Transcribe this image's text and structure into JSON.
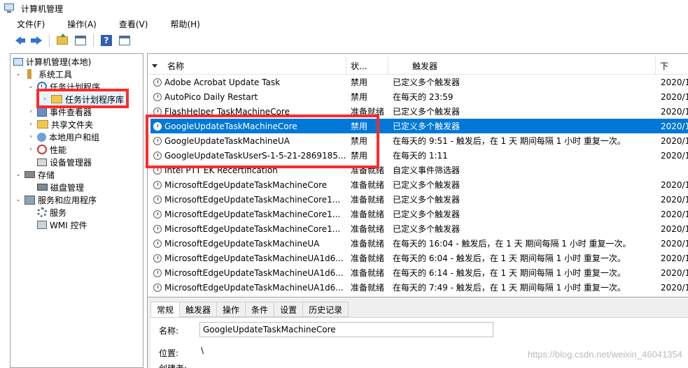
{
  "window": {
    "title": "计算机管理"
  },
  "menu": [
    "文件(F)",
    "操作(A)",
    "查看(V)",
    "帮助(H)"
  ],
  "toolbar": [
    "back-arrow-icon",
    "forward-arrow-icon",
    "folder-up-icon",
    "show-pane-icon",
    "help-icon",
    "properties-icon"
  ],
  "tree": [
    {
      "label": "计算机管理(本地)",
      "icon": "computer-icon",
      "depth": 0,
      "expander": ""
    },
    {
      "label": "系统工具",
      "icon": "tools-icon",
      "depth": 1,
      "expander": "⌄"
    },
    {
      "label": "任务计划程序",
      "icon": "clock-icon",
      "depth": 2,
      "expander": "⌄"
    },
    {
      "label": "任务计划程序库",
      "icon": "folder-clock-icon",
      "depth": 3,
      "expander": "›",
      "selected": true
    },
    {
      "label": "事件查看器",
      "icon": "event-viewer-icon",
      "depth": 2,
      "expander": "›"
    },
    {
      "label": "共享文件夹",
      "icon": "shared-folder-icon",
      "depth": 2,
      "expander": "›"
    },
    {
      "label": "本地用户和组",
      "icon": "users-icon",
      "depth": 2,
      "expander": "›"
    },
    {
      "label": "性能",
      "icon": "performance-icon",
      "depth": 2,
      "expander": "›"
    },
    {
      "label": "设备管理器",
      "icon": "device-manager-icon",
      "depth": 2,
      "expander": ""
    },
    {
      "label": "存储",
      "icon": "storage-icon",
      "depth": 1,
      "expander": "⌄"
    },
    {
      "label": "磁盘管理",
      "icon": "disk-icon",
      "depth": 2,
      "expander": ""
    },
    {
      "label": "服务和应用程序",
      "icon": "services-apps-icon",
      "depth": 1,
      "expander": "⌄"
    },
    {
      "label": "服务",
      "icon": "gear-icon",
      "depth": 2,
      "expander": ""
    },
    {
      "label": "WMI 控件",
      "icon": "wmi-icon",
      "depth": 2,
      "expander": ""
    }
  ],
  "list": {
    "columns": [
      "名称",
      "状...",
      "触发器",
      "下"
    ],
    "rows": [
      {
        "name": "Adobe Acrobat Update Task",
        "status": "禁用",
        "trigger": "已定义多个触发器",
        "next": "2020/1"
      },
      {
        "name": "AutoPico Daily Restart",
        "status": "禁用",
        "trigger": "在每天的 23:59",
        "next": "2020/1"
      },
      {
        "name": "FlashHelper TaskMachineCore",
        "status": "准备就绪",
        "trigger": "已定义多个触发器",
        "next": "2020/1"
      },
      {
        "name": "GoogleUpdateTaskMachineCore",
        "status": "禁用",
        "trigger": "已定义多个触发器",
        "next": "2020/1",
        "selected": true
      },
      {
        "name": "GoogleUpdateTaskMachineUA",
        "status": "禁用",
        "trigger": "在每天的 9:51 - 触发后，在 1 天 期间每隔 1 小时 重复一次。",
        "next": "2020/1"
      },
      {
        "name": "GoogleUpdateTaskUserS-1-5-21-2869185...",
        "status": "禁用",
        "trigger": "在每天的 1:11",
        "next": "2020/1"
      },
      {
        "name": "Intel PTT EK Recertification",
        "status": "准备就绪",
        "trigger": "自定义事件筛选器",
        "next": ""
      },
      {
        "name": "MicrosoftEdgeUpdateTaskMachineCore",
        "status": "准备就绪",
        "trigger": "已定义多个触发器",
        "next": "2020/1"
      },
      {
        "name": "MicrosoftEdgeUpdateTaskMachineCore1...",
        "status": "准备就绪",
        "trigger": "已定义多个触发器",
        "next": "2020/1"
      },
      {
        "name": "MicrosoftEdgeUpdateTaskMachineCore1...",
        "status": "准备就绪",
        "trigger": "已定义多个触发器",
        "next": "2020/1"
      },
      {
        "name": "MicrosoftEdgeUpdateTaskMachineCore1...",
        "status": "准备就绪",
        "trigger": "已定义多个触发器",
        "next": "2020/1"
      },
      {
        "name": "MicrosoftEdgeUpdateTaskMachineUA",
        "status": "准备就绪",
        "trigger": "在每天的 16:04 - 触发后，在 1 天 期间每隔 1 小时 重复一次。",
        "next": "2020/1"
      },
      {
        "name": "MicrosoftEdgeUpdateTaskMachineUA1d6...",
        "status": "准备就绪",
        "trigger": "在每天的 6:04 - 触发后，在 1 天 期间每隔 1 小时 重复一次。",
        "next": "2020/1"
      },
      {
        "name": "MicrosoftEdgeUpdateTaskMachineUA1d6...",
        "status": "准备就绪",
        "trigger": "在每天的 6:14 - 触发后，在 1 天 期间每隔 1 小时 重复一次。",
        "next": "2020/1"
      },
      {
        "name": "MicrosoftEdgeUpdateTaskMachineUA1d6...",
        "status": "准备就绪",
        "trigger": "在每天的 7:49 - 触发后，在 1 天 期间每隔 1 小时 重复一次。",
        "next": "2020/1"
      }
    ]
  },
  "detail": {
    "tabs": [
      "常规",
      "触发器",
      "操作",
      "条件",
      "设置",
      "历史记录"
    ],
    "name_label": "名称:",
    "name_value": "GoogleUpdateTaskMachineCore",
    "location_label": "位置:",
    "location_value": "\\",
    "author_label": "创建者:"
  },
  "watermark": "https://blog.csdn.net/weixin_46041354",
  "colors": {
    "selection": "#0078d7",
    "highlight_box": "#ff2a2a"
  }
}
